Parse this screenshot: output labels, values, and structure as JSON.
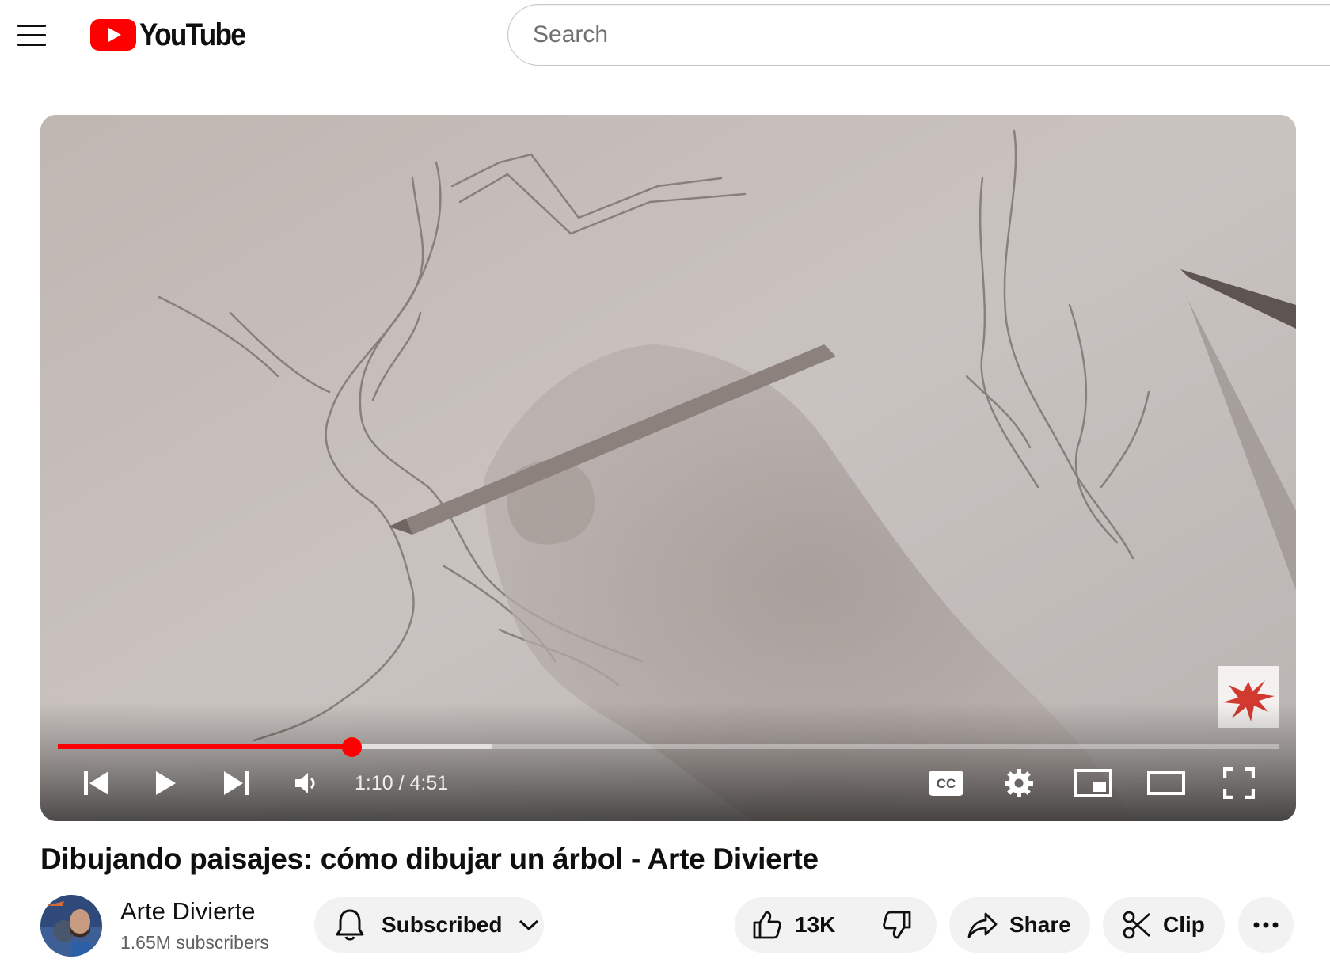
{
  "header": {
    "menu_icon": "hamburger-menu-icon",
    "logo_text": "YouTube",
    "logo_color": "#ff0000",
    "search_placeholder": "Search"
  },
  "player": {
    "current_time": "1:10",
    "duration": "4:51",
    "time_display": "1:10 / 4:51",
    "progress_fraction": 0.2405,
    "buffered_fraction": 0.355,
    "progress_color": "#ff0000",
    "controls": [
      "previous-icon",
      "play-icon",
      "next-icon",
      "volume-icon",
      "cc-icon",
      "settings-icon",
      "miniplayer-icon",
      "theater-mode-icon",
      "fullscreen-icon"
    ]
  },
  "video": {
    "title": "Dibujando paisajes: cómo dibujar un árbol - Arte Divierte"
  },
  "channel": {
    "name": "Arte Divierte",
    "subscribers": "1.65M subscribers"
  },
  "actions": {
    "subscribe_label": "Subscribed",
    "like_count": "13K",
    "share_label": "Share",
    "clip_label": "Clip"
  }
}
